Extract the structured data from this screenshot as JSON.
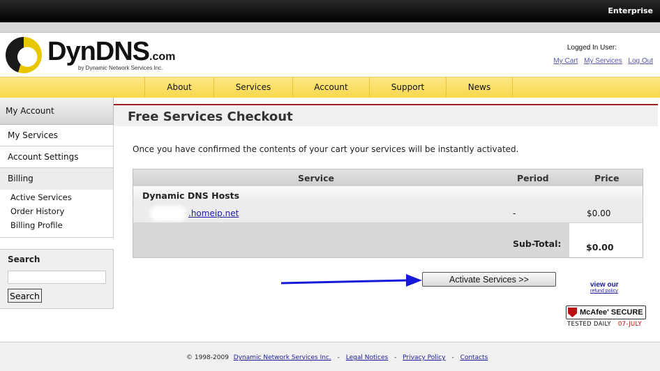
{
  "topbar": {
    "label": "Enterprise"
  },
  "logo": {
    "name": "DynDNS",
    "suffix": ".com",
    "tagline": "by Dynamic Network Services Inc."
  },
  "user": {
    "logged_in_label": "Logged In User:",
    "links": [
      {
        "label": "My Cart"
      },
      {
        "label": "My Services"
      },
      {
        "label": "Log Out"
      }
    ]
  },
  "nav": {
    "items": [
      {
        "label": "About"
      },
      {
        "label": "Services"
      },
      {
        "label": "Account"
      },
      {
        "label": "Support"
      },
      {
        "label": "News"
      }
    ]
  },
  "sidebar": {
    "header": "My Account",
    "items": [
      {
        "label": "My Services"
      },
      {
        "label": "Account Settings"
      }
    ],
    "billing": {
      "label": "Billing",
      "subitems": [
        {
          "label": "Active Services"
        },
        {
          "label": "Order History"
        },
        {
          "label": "Billing Profile"
        }
      ]
    }
  },
  "search": {
    "label": "Search",
    "button": "Search",
    "placeholder": ""
  },
  "main": {
    "title": "Free Services Checkout",
    "intro": "Once you have confirmed the contents of your cart your services will be instantly activated.",
    "table": {
      "columns": {
        "service": "Service",
        "period": "Period",
        "price": "Price"
      },
      "group": "Dynamic DNS Hosts",
      "row": {
        "service": ".homeip.net",
        "period": "-",
        "price": "$0.00"
      },
      "subtotal_label": "Sub-Total:",
      "subtotal_value": "$0.00"
    },
    "activate_button": "Activate Services >>",
    "refund": {
      "line1": "view our",
      "line2": "refund policy"
    },
    "mcafee": {
      "brand": "McAfee' SECURE",
      "tested": "TESTED DAILY",
      "date": "07-JULY"
    }
  },
  "footer": {
    "copyright": "© 1998-2009",
    "links": [
      {
        "label": "Dynamic Network Services Inc."
      },
      {
        "label": "Legal Notices"
      },
      {
        "label": "Privacy Policy"
      },
      {
        "label": "Contacts"
      }
    ]
  },
  "colors": {
    "nav_yellow": "#f8d84a",
    "title_rule": "#a32020",
    "arrow_blue": "#1818d8",
    "link": "#1a1a9c"
  }
}
